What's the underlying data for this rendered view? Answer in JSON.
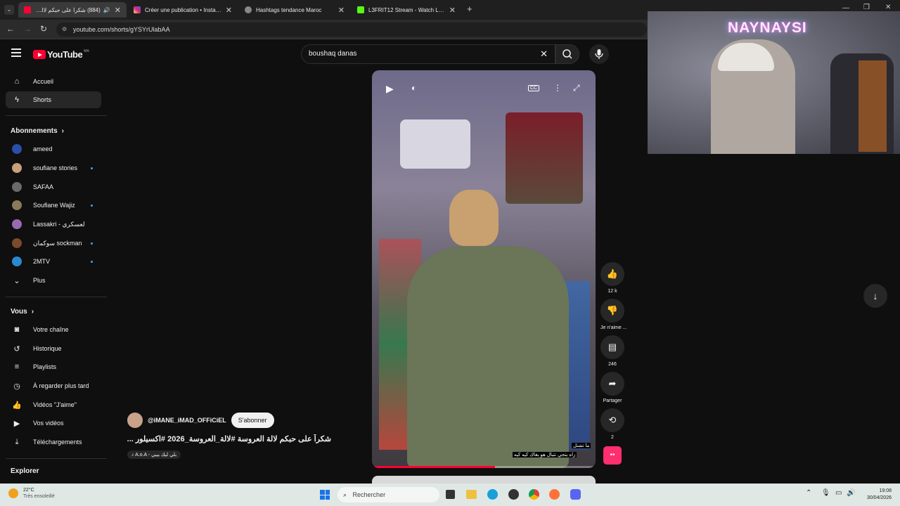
{
  "browser": {
    "tabs": [
      {
        "title": "(884) شكراً على حبكم لالة العر",
        "active": true,
        "favicon_color": "#ff0033"
      },
      {
        "title": "Créer une publication • Instagram",
        "active": false,
        "favicon_color": "#d6249f"
      },
      {
        "title": "Hashtags tendance Maroc",
        "active": false,
        "favicon_color": "#888888"
      },
      {
        "title": "L3FRIT12 Stream - Watch Live o",
        "active": false,
        "favicon_color": "#53fc18"
      }
    ],
    "url": "youtube.com/shorts/gYSYrUlabAA"
  },
  "header": {
    "logo_text": "YouTube",
    "country": "MA",
    "search_value": "boushaq danas"
  },
  "sidebar": {
    "main": [
      {
        "label": "Accueil",
        "icon": "home-icon"
      },
      {
        "label": "Shorts",
        "icon": "shorts-icon",
        "active": true
      }
    ],
    "subscriptions_title": "Abonnements",
    "subscriptions": [
      {
        "label": "ameed",
        "color": "#2a4fa8",
        "dot": false
      },
      {
        "label": "soufiane stories",
        "color": "#c8a07a",
        "dot": true
      },
      {
        "label": "SAFAA",
        "color": "#6a6a6a",
        "dot": false
      },
      {
        "label": "Soufiane Wajiz",
        "color": "#8a7a5a",
        "dot": true
      },
      {
        "label": "Lassakri - لعسكري",
        "color": "#9a6ab0",
        "dot": false
      },
      {
        "label": "سوكمان sockman",
        "color": "#7a4a2a",
        "dot": true
      },
      {
        "label": "2MTV",
        "color": "#2a8ad0",
        "dot": true
      }
    ],
    "more_label": "Plus",
    "you_title": "Vous",
    "you_items": [
      {
        "label": "Votre chaîne",
        "icon": "channel-icon"
      },
      {
        "label": "Historique",
        "icon": "history-icon"
      },
      {
        "label": "Playlists",
        "icon": "playlists-icon"
      },
      {
        "label": "À regarder plus tard",
        "icon": "watch-later-icon"
      },
      {
        "label": "Vidéos \"J'aime\"",
        "icon": "liked-icon"
      },
      {
        "label": "Vos vidéos",
        "icon": "your-videos-icon"
      },
      {
        "label": "Téléchargements",
        "icon": "downloads-icon"
      }
    ],
    "explore_title": "Explorer"
  },
  "short": {
    "channel": "@iMANE_iMAD_OFFiCiEL",
    "subscribe_label": "S'abonner",
    "title": "شكراً على حبكم لالة العروسة #لالة_العروسة_2026 #اكسيلور ...",
    "audio": "A.o.A - بلي ليك بيبي",
    "overlay_text_1": "ما تشتل",
    "overlay_text_2": "زاه بتجي تتبال هو بغاك كيه كيه",
    "progress": 0.55
  },
  "actions": {
    "likes": "12 k",
    "dislike_label": "Je n'aime ...",
    "comments": "246",
    "share_label": "Partager",
    "remix_count": "2"
  },
  "webcam": {
    "overlay_name": "NAYNAYSI"
  },
  "taskbar": {
    "weather_temp": "22°C",
    "weather_desc": "Très ensoleillé",
    "search_placeholder": "Rechercher",
    "time": "19:08",
    "date": "30/04/2026"
  }
}
